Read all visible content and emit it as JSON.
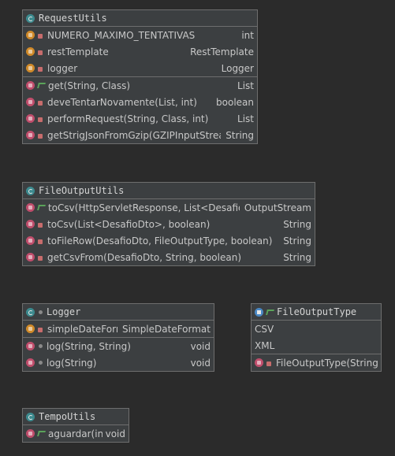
{
  "diagram": {
    "classes": [
      {
        "name": "RequestUtils",
        "kind": "class",
        "fields": [
          {
            "name": "NUMERO_MAXIMO_TENTATIVAS",
            "type": "int",
            "visibility": "private",
            "static": true
          },
          {
            "name": "restTemplate",
            "type": "RestTemplate",
            "visibility": "private"
          },
          {
            "name": "logger",
            "type": "Logger",
            "visibility": "private"
          }
        ],
        "methods": [
          {
            "name": "get(String, Class)",
            "type": "List",
            "visibility": "public"
          },
          {
            "name": "deveTentarNovamente(List, int)",
            "type": "boolean",
            "visibility": "private"
          },
          {
            "name": "performRequest(String, Class, int)",
            "type": "List",
            "visibility": "private"
          },
          {
            "name": "getStrigJsonFromGzip(GZIPInputStream)",
            "type": "String",
            "visibility": "private"
          }
        ]
      },
      {
        "name": "FileOutputUtils",
        "kind": "class",
        "fields": [],
        "methods": [
          {
            "name": "toCsv(HttpServletResponse, List<DesafioDto>)",
            "type": "OutputStream",
            "visibility": "public"
          },
          {
            "name": "toCsv(List<DesafioDto>, boolean)",
            "type": "String",
            "visibility": "private"
          },
          {
            "name": "toFileRow(DesafioDto, FileOutputType, boolean)",
            "type": "String",
            "visibility": "private"
          },
          {
            "name": "getCsvFrom(DesafioDto, String, boolean)",
            "type": "String",
            "visibility": "private"
          }
        ]
      },
      {
        "name": "Logger",
        "kind": "class",
        "fields": [
          {
            "name": "simpleDateFormat",
            "type": "SimpleDateFormat",
            "visibility": "private"
          }
        ],
        "methods": [
          {
            "name": "log(String, String)",
            "type": "void",
            "visibility": "package"
          },
          {
            "name": "log(String)",
            "type": "void",
            "visibility": "package"
          }
        ]
      },
      {
        "name": "FileOutputType",
        "kind": "enum",
        "constants": [
          "CSV",
          "XML"
        ],
        "methods": [
          {
            "name": "FileOutputType(String)",
            "type": "",
            "visibility": "private"
          }
        ]
      },
      {
        "name": "TempoUtils",
        "kind": "class",
        "fields": [],
        "methods": [
          {
            "name": "aguardar(int)",
            "type": "void",
            "visibility": "public",
            "static": true
          }
        ]
      }
    ]
  },
  "colors": {
    "background": "#2b2b2b",
    "box": "#3c3f41",
    "border": "#6e6e6e",
    "field_icon": "#d08a29",
    "method_icon": "#c04e6c",
    "class_icon": "#3c8a8e",
    "enum_icon": "#4a88c4"
  }
}
